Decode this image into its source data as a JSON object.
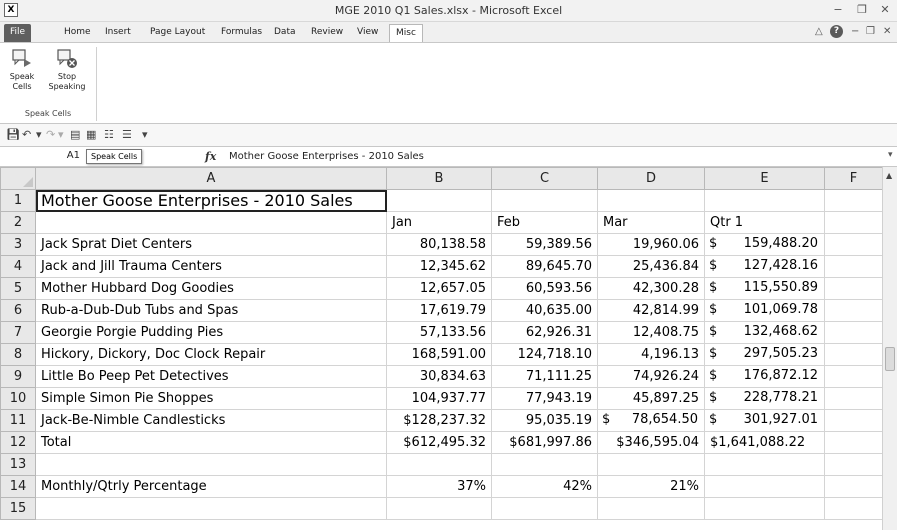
{
  "window": {
    "title": "MGE 2010 Q1 Sales.xlsx - Microsoft Excel",
    "controls": [
      "−",
      "❐",
      "✕"
    ]
  },
  "ribbon": {
    "tabs": [
      "File",
      "Home",
      "Insert",
      "Page Layout",
      "Formulas",
      "Data",
      "Review",
      "View",
      "Misc"
    ],
    "active_tab": "Misc",
    "right_controls": [
      "△",
      "?",
      "−",
      "❐",
      "✕"
    ],
    "buttons": [
      {
        "line1": "Speak",
        "line2": "Cells"
      },
      {
        "line1": "Stop",
        "line2": "Speaking"
      }
    ],
    "group_label": "Speak Cells"
  },
  "formula_bar": {
    "name_box": "A1",
    "tooltip": "Speak Cells",
    "fx": "fx",
    "formula": "Mother Goose Enterprises - 2010 Sales"
  },
  "sheet": {
    "columns": [
      "A",
      "B",
      "C",
      "D",
      "E",
      "F"
    ],
    "rows": [
      {
        "n": "1",
        "a": "Mother Goose Enterprises - 2010 Sales",
        "b": "",
        "c": "",
        "d": "",
        "e": ""
      },
      {
        "n": "2",
        "a": "",
        "b": "Jan",
        "c": "Feb",
        "d": "Mar",
        "e": "Qtr 1"
      },
      {
        "n": "3",
        "a": "Jack Sprat Diet Centers",
        "b": "80,138.58",
        "c": "59,389.56",
        "d": "19,960.06",
        "e": "159,488.20"
      },
      {
        "n": "4",
        "a": "Jack and Jill Trauma Centers",
        "b": "12,345.62",
        "c": "89,645.70",
        "d": "25,436.84",
        "e": "127,428.16"
      },
      {
        "n": "5",
        "a": "Mother Hubbard Dog Goodies",
        "b": "12,657.05",
        "c": "60,593.56",
        "d": "42,300.28",
        "e": "115,550.89"
      },
      {
        "n": "6",
        "a": "Rub-a-Dub-Dub Tubs and Spas",
        "b": "17,619.79",
        "c": "40,635.00",
        "d": "42,814.99",
        "e": "101,069.78"
      },
      {
        "n": "7",
        "a": "Georgie Porgie Pudding Pies",
        "b": "57,133.56",
        "c": "62,926.31",
        "d": "12,408.75",
        "e": "132,468.62"
      },
      {
        "n": "8",
        "a": "Hickory, Dickory, Doc Clock Repair",
        "b": "168,591.00",
        "c": "124,718.10",
        "d": "4,196.13",
        "e": "297,505.23"
      },
      {
        "n": "9",
        "a": "Little Bo Peep Pet Detectives",
        "b": "30,834.63",
        "c": "71,111.25",
        "d": "74,926.24",
        "e": "176,872.12"
      },
      {
        "n": "10",
        "a": "Simple Simon Pie Shoppes",
        "b": "104,937.77",
        "c": "77,943.19",
        "d": "45,897.25",
        "e": "228,778.21"
      },
      {
        "n": "11",
        "a": "Jack-Be-Nimble Candlesticks",
        "b": "$128,237.32",
        "c": "95,035.19",
        "d": "78,654.50",
        "e": "301,927.01"
      },
      {
        "n": "12",
        "a": "Total",
        "b": "$612,495.32",
        "c": "$681,997.86",
        "d": "$346,595.04",
        "e": "$1,641,088.22"
      },
      {
        "n": "13",
        "a": "",
        "b": "",
        "c": "",
        "d": "",
        "e": ""
      },
      {
        "n": "14",
        "a": "Monthly/Qtrly Percentage",
        "b": "37%",
        "c": "42%",
        "d": "21%",
        "e": ""
      },
      {
        "n": "15",
        "a": "",
        "b": "",
        "c": "",
        "d": "",
        "e": ""
      }
    ],
    "currency_symbol": "$"
  }
}
